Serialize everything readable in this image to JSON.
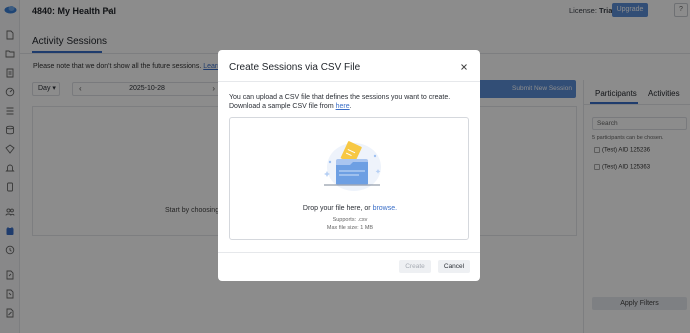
{
  "header": {
    "project_title": "4840: My Health Pal",
    "license_label": "License:",
    "license_value": "Trial",
    "upgrade_label": "Upgrade",
    "help_label": "?"
  },
  "rail_icons": [
    "logo-icon",
    "file-icon",
    "folder-icon",
    "document-icon",
    "dashboard-icon",
    "list-icon",
    "database-icon",
    "diamond-icon",
    "bell-icon",
    "phone-icon",
    "users-icon",
    "calendar-icon",
    "history-icon",
    "export-icon",
    "import-icon",
    "transfer-icon"
  ],
  "page": {
    "title": "Activity Sessions",
    "notice": "Please note that we don't show all the future sessions.",
    "notice_link": "Learn more",
    "day_select": "Day",
    "date_value": "2025-10-28",
    "submit_new_session": "Submit New Session",
    "empty_state": "Start by choosing"
  },
  "side_panel": {
    "tab_participants": "Participants",
    "tab_activities": "Activities",
    "search_placeholder": "Search",
    "count_text": "5 participants can be chosen.",
    "participants": [
      "(Test) AID 125236",
      "(Test) AID 125363"
    ],
    "apply_filters": "Apply Filters"
  },
  "modal": {
    "title": "Create Sessions via CSV File",
    "description": "You can upload a CSV file that defines the sessions you want to create. Download a sample CSV file from",
    "description_link": "here",
    "drop_text": "Drop your file here, or",
    "browse_link": "browse.",
    "supports": "Supports: .csv",
    "max_size": "Max file size: 1 MB",
    "create_label": "Create",
    "cancel_label": "Cancel"
  },
  "colors": {
    "accent": "#3a6ec7",
    "button_blue": "#5b8ed8",
    "overlay": "rgba(0,0,0,0.45)"
  }
}
